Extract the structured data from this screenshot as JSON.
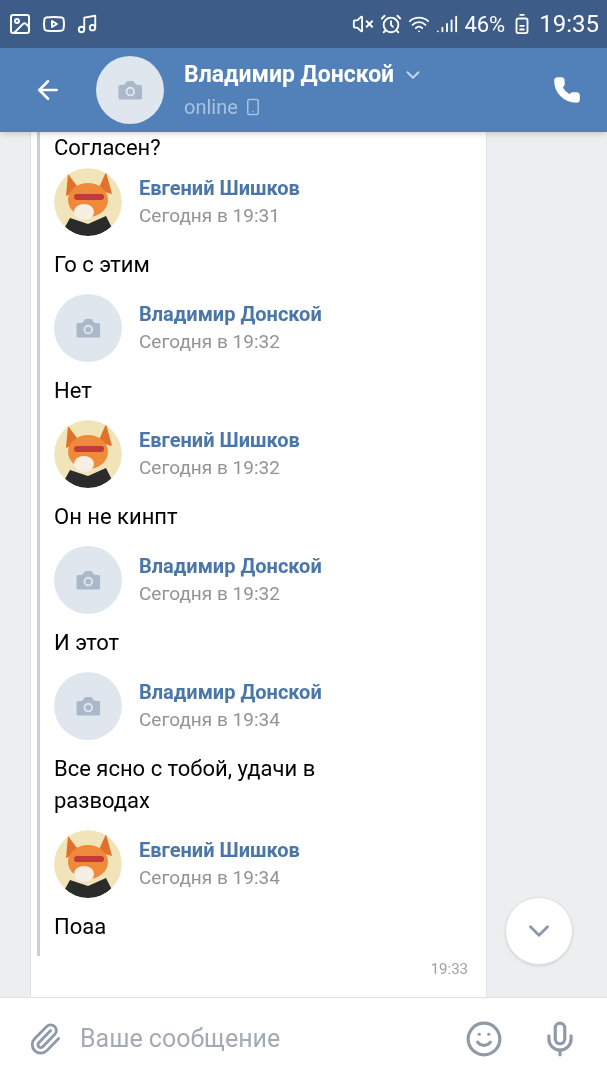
{
  "status_bar": {
    "battery": "46%",
    "time": "19:35"
  },
  "header": {
    "name": "Владимир Донской",
    "status": "online"
  },
  "messages": [
    {
      "kind": "text",
      "text": "Согласен?"
    },
    {
      "kind": "author",
      "name": "Евгений Шишков",
      "time": "Сегодня в 19:31"
    },
    {
      "kind": "text",
      "text": "Го с этим"
    },
    {
      "kind": "author",
      "name": "Владимир Донской",
      "time": "Сегодня в 19:32",
      "avatar": {
        "kind": "camera"
      }
    },
    {
      "kind": "text",
      "text": "Нет"
    },
    {
      "kind": "author",
      "name": "Евгений Шишков",
      "time": "Сегодня в 19:32"
    },
    {
      "kind": "text",
      "text": "Он не кинпт"
    },
    {
      "kind": "author",
      "name": "Владимир Донской",
      "time": "Сегодня в 19:32",
      "avatar": {
        "kind": "camera"
      }
    },
    {
      "kind": "text",
      "text": "И этот"
    },
    {
      "kind": "author",
      "name": "Владимир Донской",
      "time": "Сегодня в 19:34",
      "avatar": {
        "kind": "camera"
      }
    },
    {
      "kind": "text",
      "text": "Все ясно с тобой, удачи в разводах"
    },
    {
      "kind": "author",
      "name": "Евгений Шишков",
      "time": "Сегодня в 19:34"
    },
    {
      "kind": "text",
      "text": "Поаа"
    }
  ],
  "bubble_time": "19:33",
  "composer": {
    "placeholder": "Ваше сообщение"
  }
}
